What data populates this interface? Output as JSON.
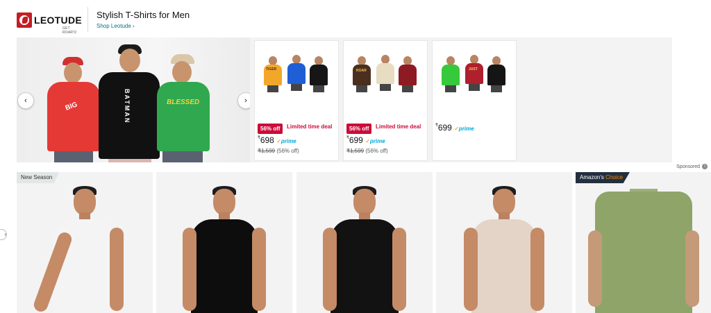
{
  "brand": {
    "logo_text": "LEOTUDE",
    "logo_tagline": "GET ROAR'D",
    "title": "Stylish T-Shirts for Men",
    "shop_link": "Shop Leotude ›"
  },
  "hero": {
    "prev_icon": "chevron-left-icon",
    "next_icon": "chevron-right-icon",
    "prev_label": "‹",
    "next_label": "›",
    "shirt_prints": [
      "BIG",
      "BATMAN",
      "BLESSED"
    ]
  },
  "products": [
    {
      "print": "TIGER",
      "deal_badge": "56% off",
      "deal_text": "Limited time deal",
      "currency": "₹",
      "price": "698",
      "prime": "prime",
      "mrp": "₹1,599",
      "discount": "(56% off)"
    },
    {
      "print": "ROAR",
      "deal_badge": "56% off",
      "deal_text": "Limited time deal",
      "currency": "₹",
      "price": "699",
      "prime": "prime",
      "mrp": "₹1,599",
      "discount": "(56% off)"
    },
    {
      "print": "JUST",
      "currency": "₹",
      "price": "699",
      "prime": "prime"
    }
  ],
  "sponsored": "Sponsored",
  "grid": {
    "cards": [
      {
        "badge": "New Season"
      },
      {},
      {},
      {},
      {
        "badge_prefix": "Amazon's ",
        "badge_highlight": "Choice"
      }
    ]
  },
  "colors": {
    "link": "#007185",
    "deal_red": "#cc0c39",
    "prime_blue": "#00a8e1",
    "badge_dark": "#232f3e",
    "choice_orange": "#f08804"
  }
}
